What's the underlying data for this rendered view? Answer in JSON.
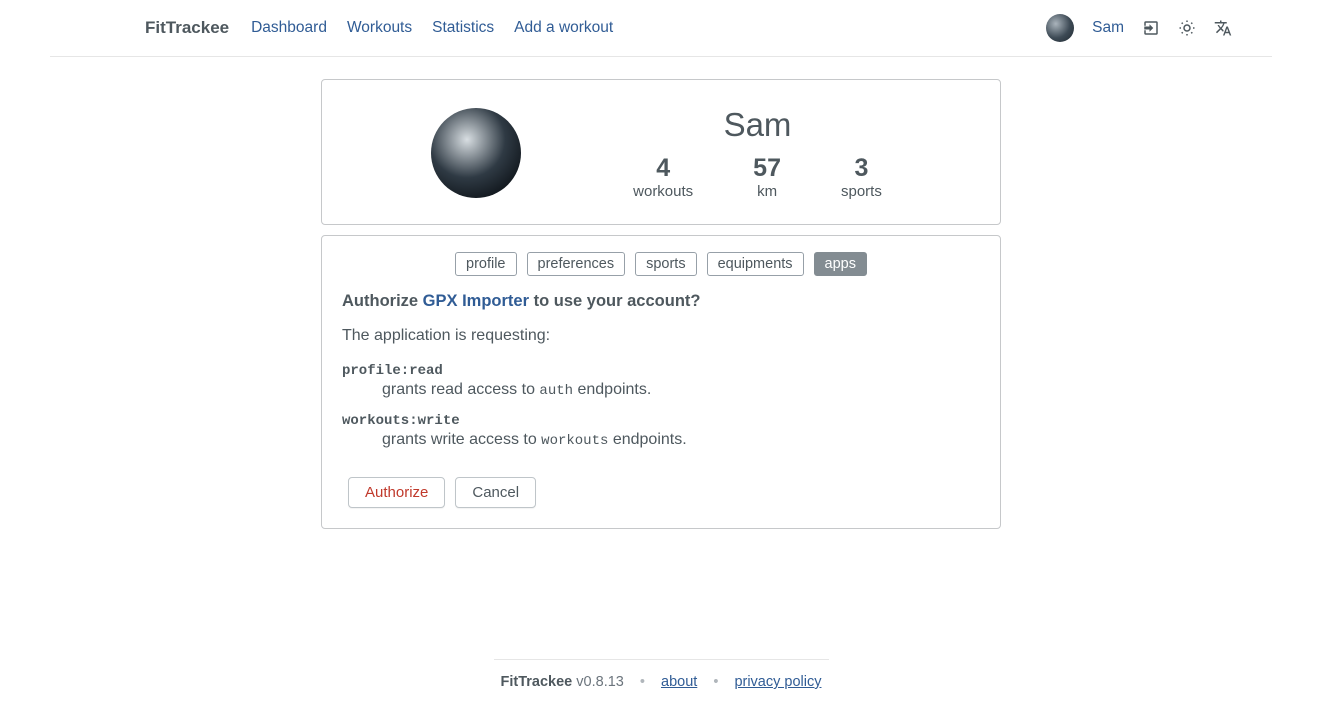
{
  "brand": "FitTrackee",
  "nav": {
    "dashboard": "Dashboard",
    "workouts": "Workouts",
    "statistics": "Statistics",
    "add_workout": "Add a workout",
    "username": "Sam"
  },
  "profile": {
    "name": "Sam",
    "stats": {
      "workouts_num": "4",
      "workouts_label": "workouts",
      "km_num": "57",
      "km_label": "km",
      "sports_num": "3",
      "sports_label": "sports"
    }
  },
  "tabs": {
    "profile": "profile",
    "preferences": "preferences",
    "sports": "sports",
    "equipments": "equipments",
    "apps": "apps"
  },
  "auth": {
    "prefix": "Authorize ",
    "app_name": "GPX Importer",
    "suffix": " to use your account?",
    "requesting": "The application is requesting:",
    "scopes": [
      {
        "name": "profile:read",
        "desc_pre": "grants read access to ",
        "desc_code": "auth",
        "desc_post": " endpoints."
      },
      {
        "name": "workouts:write",
        "desc_pre": "grants write access to ",
        "desc_code": "workouts",
        "desc_post": " endpoints."
      }
    ],
    "authorize_btn": "Authorize",
    "cancel_btn": "Cancel"
  },
  "footer": {
    "brand": "FitTrackee",
    "version": " v0.8.13",
    "about": "about",
    "privacy": "privacy policy"
  }
}
